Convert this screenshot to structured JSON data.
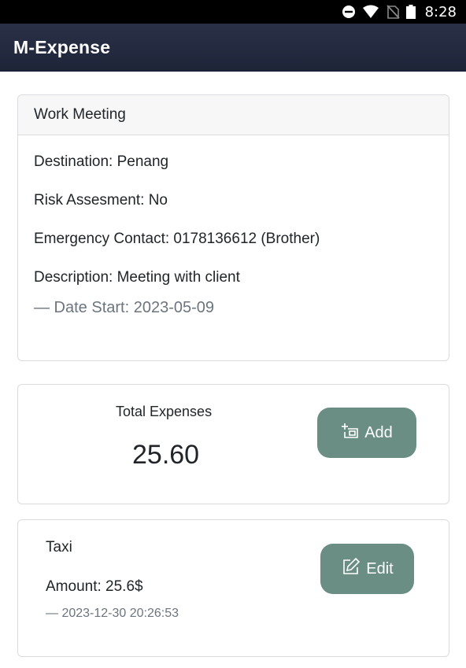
{
  "status_bar": {
    "time": "8:28",
    "icons": [
      "do-not-disturb-icon",
      "wifi-icon",
      "no-sim-icon",
      "battery-icon"
    ]
  },
  "app_bar": {
    "title": "M-Expense"
  },
  "trip": {
    "name": "Work Meeting",
    "destination": "Destination: Penang",
    "risk_assessment": "Risk Assesment: No",
    "emergency_contact": "Emergency Contact: 0178136612 (Brother)",
    "description": "Description: Meeting with client",
    "date_start": "— Date Start: 2023-05-09"
  },
  "summary": {
    "total_label": "Total Expenses",
    "total_value": "25.60",
    "add_label": "Add",
    "add_icon": "add-receipt-icon"
  },
  "expenses": [
    {
      "type": "Taxi",
      "amount": "Amount: 25.6$",
      "datetime": "— 2023-12-30 20:26:53",
      "edit_label": "Edit",
      "edit_icon": "edit-icon"
    }
  ],
  "colors": {
    "app_bar": "#232a3f",
    "button": "#6a8e84",
    "muted_text": "#6c757d",
    "border": "#d9dbdf"
  }
}
